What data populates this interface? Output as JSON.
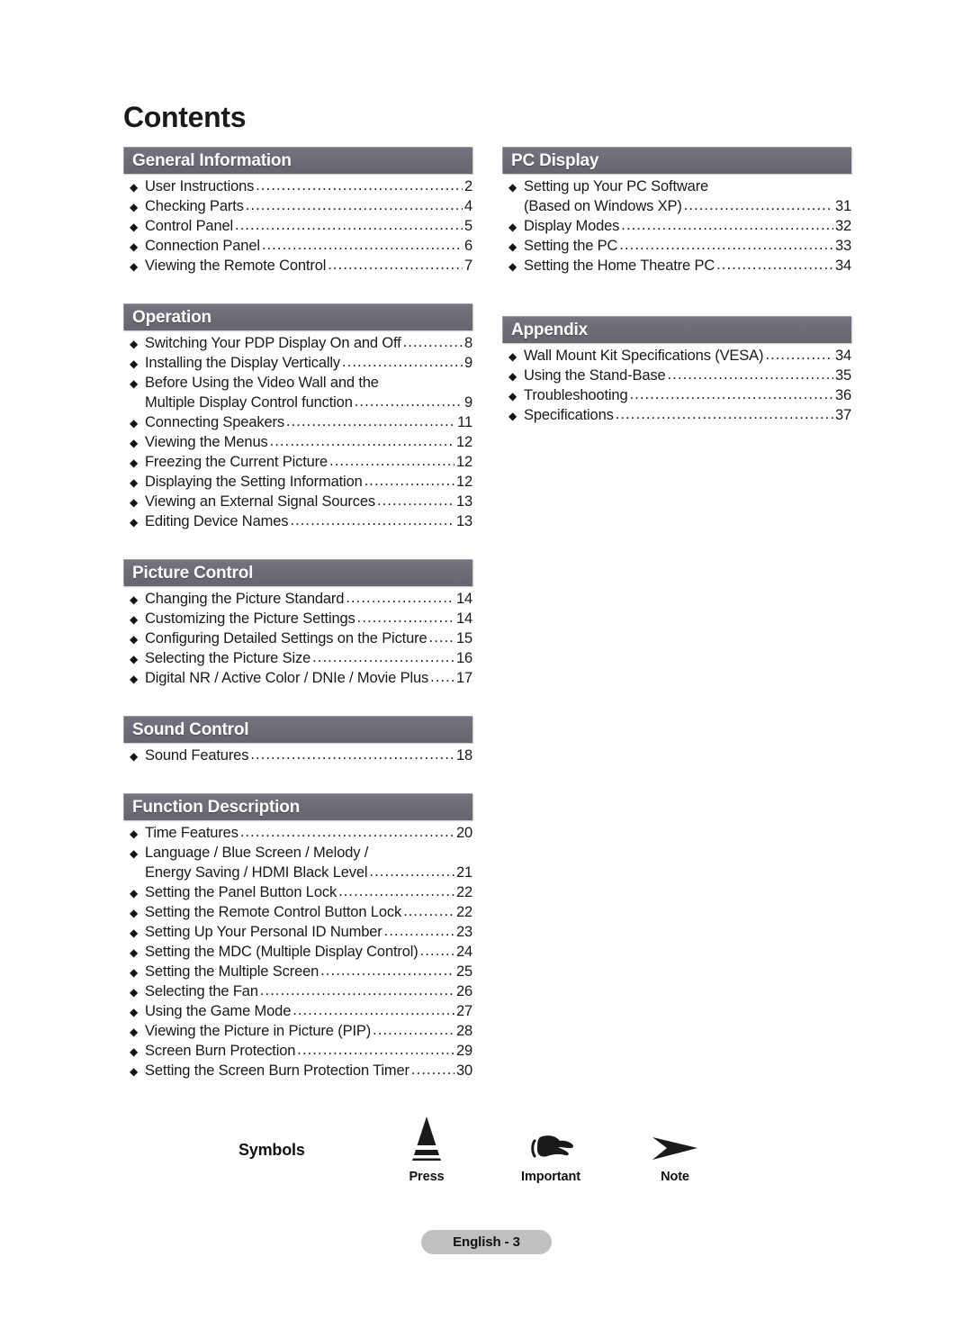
{
  "page": {
    "title": "Contents",
    "footer_label": "English - 3"
  },
  "symbols": {
    "label": "Symbols",
    "items": [
      {
        "icon": "press-triangle-icon",
        "caption": "Press"
      },
      {
        "icon": "pointing-hand-icon",
        "caption": "Important"
      },
      {
        "icon": "note-arrow-icon",
        "caption": "Note"
      }
    ]
  },
  "bullet_glyph": "◆",
  "colors": {
    "section_bar": "#6d6d78",
    "section_bar_text": "#ffffff",
    "footer_pill": "#c0c0c0",
    "body_text": "#1a1a1a"
  },
  "columns": {
    "left": [
      {
        "title": "General Information",
        "entries": [
          {
            "lines": [
              "User Instructions"
            ],
            "page": "2"
          },
          {
            "lines": [
              "Checking Parts"
            ],
            "page": "4"
          },
          {
            "lines": [
              "Control Panel "
            ],
            "page": "5"
          },
          {
            "lines": [
              "Connection Panel"
            ],
            "page": "6"
          },
          {
            "lines": [
              "Viewing the Remote Control "
            ],
            "page": "7"
          }
        ]
      },
      {
        "title": "Operation",
        "entries": [
          {
            "lines": [
              "Switching Your PDP Display On and Off"
            ],
            "page": "8"
          },
          {
            "lines": [
              "Installing the Display Vertically"
            ],
            "page": "9"
          },
          {
            "lines": [
              "Before Using the Video Wall and the",
              "Multiple Display Control function"
            ],
            "page": "9"
          },
          {
            "lines": [
              "Connecting Speakers"
            ],
            "page": "11"
          },
          {
            "lines": [
              "Viewing the Menus"
            ],
            "page": "12"
          },
          {
            "lines": [
              "Freezing the Current Picture"
            ],
            "page": "12"
          },
          {
            "lines": [
              "Displaying the Setting Information "
            ],
            "page": "12"
          },
          {
            "lines": [
              "Viewing an External Signal Sources "
            ],
            "page": "13"
          },
          {
            "lines": [
              "Editing Device Names"
            ],
            "page": "13"
          }
        ]
      },
      {
        "title": "Picture Control",
        "entries": [
          {
            "lines": [
              "Changing the Picture Standard"
            ],
            "page": "14"
          },
          {
            "lines": [
              "Customizing the Picture Settings "
            ],
            "page": "14"
          },
          {
            "lines": [
              "Configuring Detailed Settings on the Picture "
            ],
            "page": "15"
          },
          {
            "lines": [
              "Selecting the Picture Size "
            ],
            "page": "16"
          },
          {
            "lines": [
              "Digital NR / Active Color / DNIe / Movie Plus"
            ],
            "page": "17"
          }
        ]
      },
      {
        "title": "Sound Control",
        "entries": [
          {
            "lines": [
              "Sound Features "
            ],
            "page": "18"
          }
        ]
      },
      {
        "title": "Function Description",
        "entries": [
          {
            "lines": [
              "Time Features"
            ],
            "page": "20"
          },
          {
            "lines": [
              "Language / Blue Screen / Melody /",
              "Energy Saving / HDMI Black Level "
            ],
            "page": "21"
          },
          {
            "lines": [
              "Setting the Panel Button Lock"
            ],
            "page": "22"
          },
          {
            "lines": [
              "Setting the Remote Control Button Lock"
            ],
            "page": "22"
          },
          {
            "lines": [
              "Setting Up Your Personal ID Number "
            ],
            "page": "23"
          },
          {
            "lines": [
              "Setting the MDC (Multiple Display Control) "
            ],
            "page": "24"
          },
          {
            "lines": [
              "Setting the Multiple Screen "
            ],
            "page": "25"
          },
          {
            "lines": [
              "Selecting the Fan "
            ],
            "page": "26"
          },
          {
            "lines": [
              "Using the Game Mode "
            ],
            "page": "27"
          },
          {
            "lines": [
              "Viewing the Picture in Picture (PIP) "
            ],
            "page": "28"
          },
          {
            "lines": [
              "Screen Burn Protection"
            ],
            "page": "29"
          },
          {
            "lines": [
              "Setting the Screen Burn Protection Timer"
            ],
            "page": "30"
          }
        ]
      }
    ],
    "right": [
      {
        "title": "PC Display",
        "entries": [
          {
            "lines": [
              "Setting up Your PC Software",
              "(Based on Windows XP) "
            ],
            "page": "31"
          },
          {
            "lines": [
              "Display Modes "
            ],
            "page": "32"
          },
          {
            "lines": [
              "Setting the PC"
            ],
            "page": "33"
          },
          {
            "lines": [
              "Setting the Home Theatre PC"
            ],
            "page": "34"
          }
        ]
      },
      {
        "title": "Appendix",
        "entries": [
          {
            "lines": [
              "Wall Mount Kit Specifications (VESA)"
            ],
            "page": "34"
          },
          {
            "lines": [
              "Using the Stand-Base "
            ],
            "page": "35"
          },
          {
            "lines": [
              "Troubleshooting "
            ],
            "page": "36"
          },
          {
            "lines": [
              "Specifications"
            ],
            "page": "37"
          }
        ]
      }
    ]
  }
}
